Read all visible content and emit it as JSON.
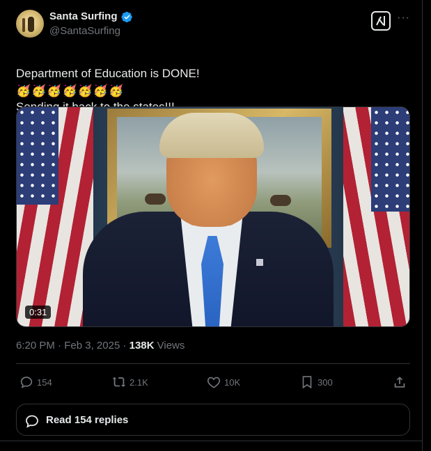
{
  "author": {
    "name": "Santa Surfing",
    "handle": "@SantaSurfing",
    "verified": true
  },
  "tweet": {
    "text_line1": "Department of Education is DONE!",
    "text_line2": "Sending it back to the states!!!",
    "emojis": "🥳🥳🥳🥳🥳🥳🥳"
  },
  "media": {
    "duration": "0:31"
  },
  "meta": {
    "time": "6:20 PM",
    "sep1": " · ",
    "date": "Feb 3, 2025",
    "sep2": " · ",
    "views_count": "138K",
    "views_label": " Views"
  },
  "actions": {
    "replies": "154",
    "reposts": "2.1K",
    "likes": "10K",
    "bookmarks": "300"
  },
  "read_replies": {
    "label": "Read 154 replies"
  },
  "colors": {
    "background": "#000000",
    "text": "#e7e9ea",
    "muted": "#71767b",
    "border": "#2f3336",
    "verified": "#1d9bf0"
  }
}
